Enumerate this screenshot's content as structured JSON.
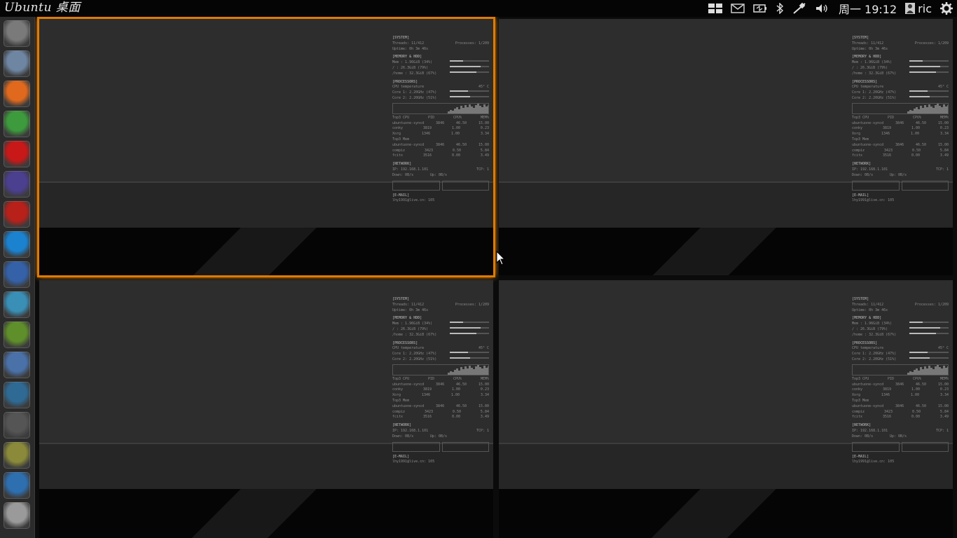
{
  "panel": {
    "title": "Ubuntu 桌面",
    "clock": "周一 19:12",
    "user": "ric",
    "indicators": [
      "workspace-switcher-icon",
      "mail-icon",
      "battery-icon",
      "bluetooth-icon",
      "network-icon",
      "volume-icon"
    ]
  },
  "launcher": {
    "items": [
      {
        "name": "dash-home",
        "color": "#7a7a7a"
      },
      {
        "name": "files",
        "color": "#6f86a3"
      },
      {
        "name": "firefox",
        "color": "#e0691e"
      },
      {
        "name": "chrome",
        "color": "#3d9b3d"
      },
      {
        "name": "opera",
        "color": "#c81818"
      },
      {
        "name": "eclipse",
        "color": "#4b3f8f"
      },
      {
        "name": "filezilla",
        "color": "#b8201a"
      },
      {
        "name": "teamviewer",
        "color": "#1b82d0"
      },
      {
        "name": "thunderbird",
        "color": "#3461a8"
      },
      {
        "name": "software-center",
        "color": "#3a8fb6"
      },
      {
        "name": "unity-tweak",
        "color": "#5f8f2a"
      },
      {
        "name": "sdk-manager",
        "color": "#4a71a8"
      },
      {
        "name": "system-monitor",
        "color": "#2f6a94"
      },
      {
        "name": "calculator",
        "color": "#555555"
      },
      {
        "name": "notes",
        "color": "#8a8a3a"
      },
      {
        "name": "workspaces",
        "color": "#2e6fb0"
      },
      {
        "name": "drive",
        "color": "#9a9a9a"
      }
    ]
  },
  "conky": {
    "system": "[SYSTEM]",
    "threads": "Threads:  11/412",
    "processes": "Processes:  1/209",
    "uptime": "Uptime:  0h 3m 46s",
    "memory_h": "[MEMORY & HDD]",
    "mem": "Mem   : 1.96GiB (34%)",
    "root": "/     : 26.3GiB (79%)",
    "home": "/home : 32.3GiB (67%)",
    "proc_h": "[PROCESSORS]",
    "cputemp": "CPU temperature",
    "cputemp_v": "45° C",
    "core1": "Core 1: 2.20GHz (47%)",
    "core2": "Core 2: 2.20GHz (51%)",
    "top_cpu": "Top3 CPU",
    "pid": "PID",
    "cpu_pct": "CPU%",
    "mem_pct": "MEM%",
    "cpu_rows": [
      [
        "ubuntuone-syncd",
        "3846",
        "46.50",
        "15.00"
      ],
      [
        "conky",
        "3819",
        "1.00",
        "0.23"
      ],
      [
        "Xorg",
        "1346",
        "1.00",
        "3.34"
      ]
    ],
    "top_mem": "Top3 Mem",
    "mem_rows": [
      [
        "ubuntuone-syncd",
        "3846",
        "46.50",
        "15.00"
      ],
      [
        "compiz",
        "3423",
        "0.50",
        "5.84"
      ],
      [
        "fcitx",
        "3516",
        "0.00",
        "3.49"
      ]
    ],
    "net_h": "[NETWORK]",
    "ip": "IP: 192.168.1.101",
    "tcp": "TCP: 1",
    "down": "Down: 0B/s",
    "up": "Up: 0B/s",
    "email_h": "[E-MAIL]",
    "email": "lhy1991@live.cn: 105"
  },
  "workspaces": [
    {
      "name": "workspace-1",
      "selected": true
    },
    {
      "name": "workspace-2",
      "selected": false
    },
    {
      "name": "workspace-3",
      "selected": false
    },
    {
      "name": "workspace-4",
      "selected": false
    }
  ],
  "colors": {
    "selection": "#e07b00",
    "panel": "#050505",
    "launcher": "#2b2b2b"
  }
}
